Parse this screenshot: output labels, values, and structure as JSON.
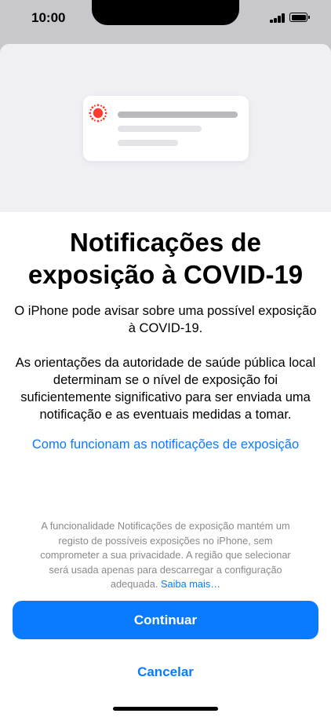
{
  "status_bar": {
    "time": "10:00",
    "signal_icon": "cellular-signal-icon",
    "battery_icon": "battery-full-icon"
  },
  "hero": {
    "card_icon": "exposure-notification-icon",
    "icon_color": "#ff3b30"
  },
  "content": {
    "title": "Notificações de exposição à COVID-19",
    "intro": "O iPhone pode avisar sobre uma possível exposição à COVID-19.",
    "details": "As orientações da autoridade de saúde pública local determinam se o nível de exposição foi suficientemente significativo para ser enviada uma notificação e as eventuais medidas a tomar.",
    "learn_link": "Como funcionam as notificações de exposição"
  },
  "footer": {
    "note": "A funcionalidade Notificações de exposição mantém um registo de possíveis exposições no iPhone, sem comprometer a sua privacidade. A região que selecionar será usada apenas para descarregar a configuração adequada.",
    "more_link": "Saiba mais…"
  },
  "actions": {
    "continue_label": "Continuar",
    "cancel_label": "Cancelar"
  },
  "colors": {
    "accent": "#0a7aff",
    "backdrop": "#c8c8cc",
    "hero_background": "#efeff4"
  }
}
